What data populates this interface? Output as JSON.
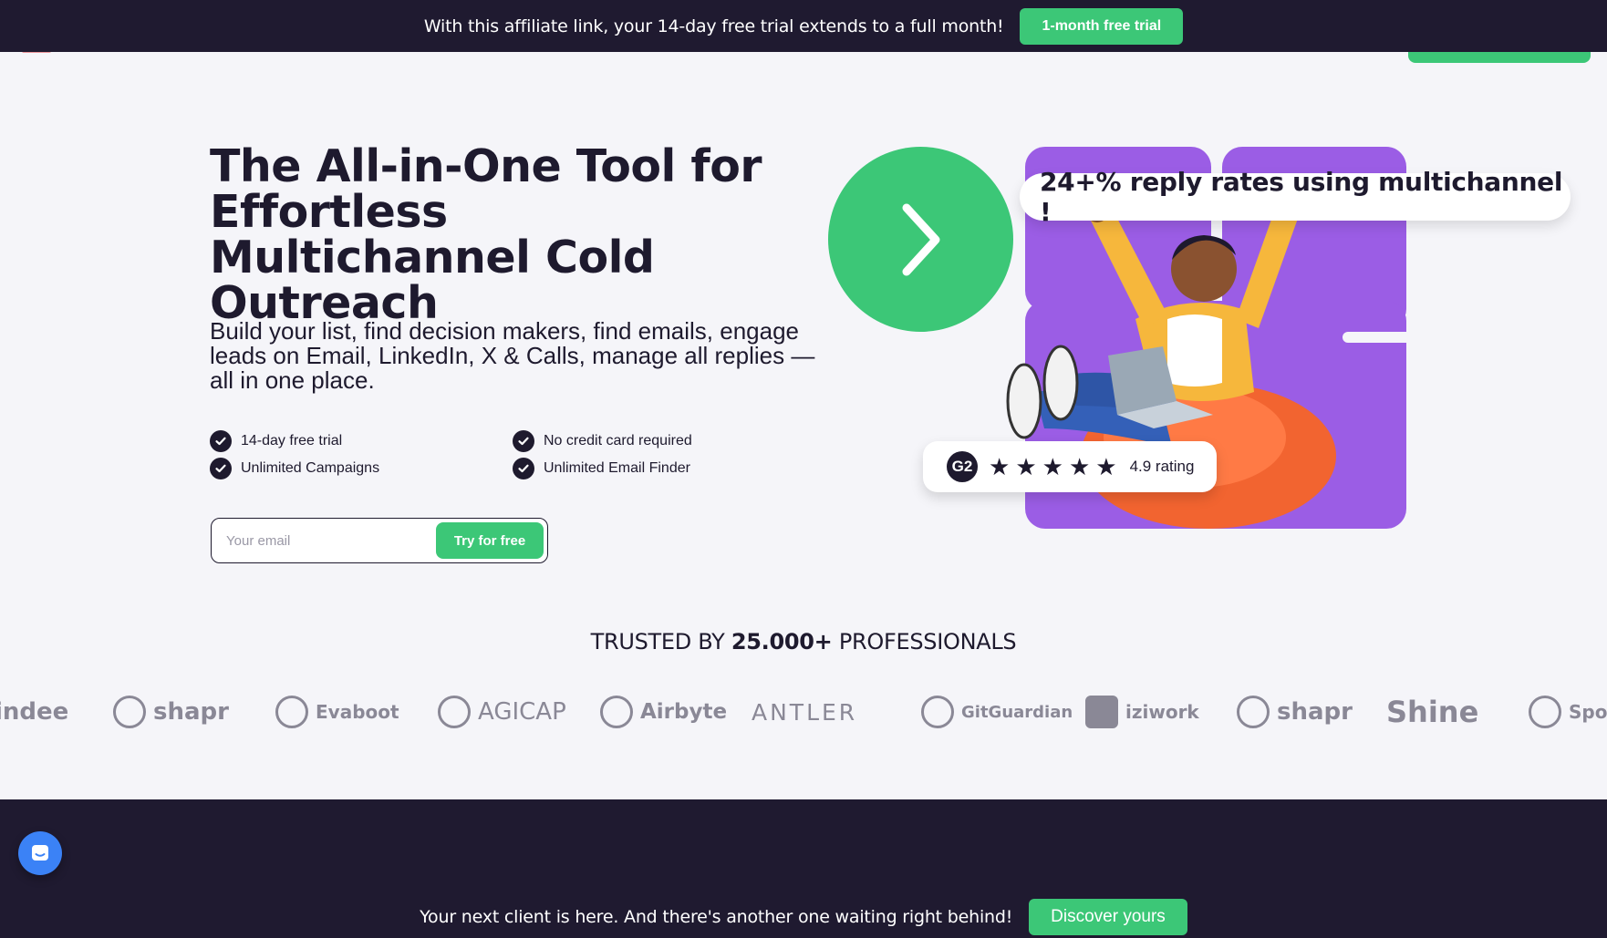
{
  "top_banner": {
    "message": "With this affiliate link, your 14-day free trial extends to a full month!",
    "cta_label": "1-month free trial"
  },
  "hero": {
    "title": "The All-in-One Tool for Effortless Multichannel Cold Outreach",
    "subtitle": "Build your list, find decision makers, find emails, engage leads on Email, LinkedIn, X & Calls, manage all replies — all in one place.",
    "features": [
      "14-day free trial",
      "No credit card required",
      "Unlimited Campaigns",
      "Unlimited Email Finder"
    ],
    "email_placeholder": "Your email",
    "email_value": "",
    "cta_label": "Try for free"
  },
  "visual": {
    "reply_rate_text": "24+% reply rates using multichannel !",
    "rating_logo": "G2",
    "rating_stars": 5,
    "rating_text": "4.9 rating"
  },
  "trusted": {
    "prefix": "TRUSTED BY",
    "count": "25.000+",
    "suffix": "PROFESSIONALS"
  },
  "logos": [
    "indee",
    "shapr",
    "Evaboot",
    "AGICAP",
    "Airbyte",
    "ANTLER",
    "GitGuardian",
    "iziwork",
    "shapr",
    "Shine",
    "Spotify"
  ],
  "bottom_bar": {
    "message": "Your next client is here. And there's another one waiting right behind!",
    "cta_label": "Discover yours"
  },
  "colors": {
    "brand_green": "#3cc777",
    "dark_navy": "#1f1a30",
    "purple": "#9b5de5",
    "chat_blue": "#3b82f6"
  },
  "icons": [
    "check-icon",
    "chevron-right-icon",
    "star-icon",
    "chat-icon",
    "g2-logo"
  ]
}
